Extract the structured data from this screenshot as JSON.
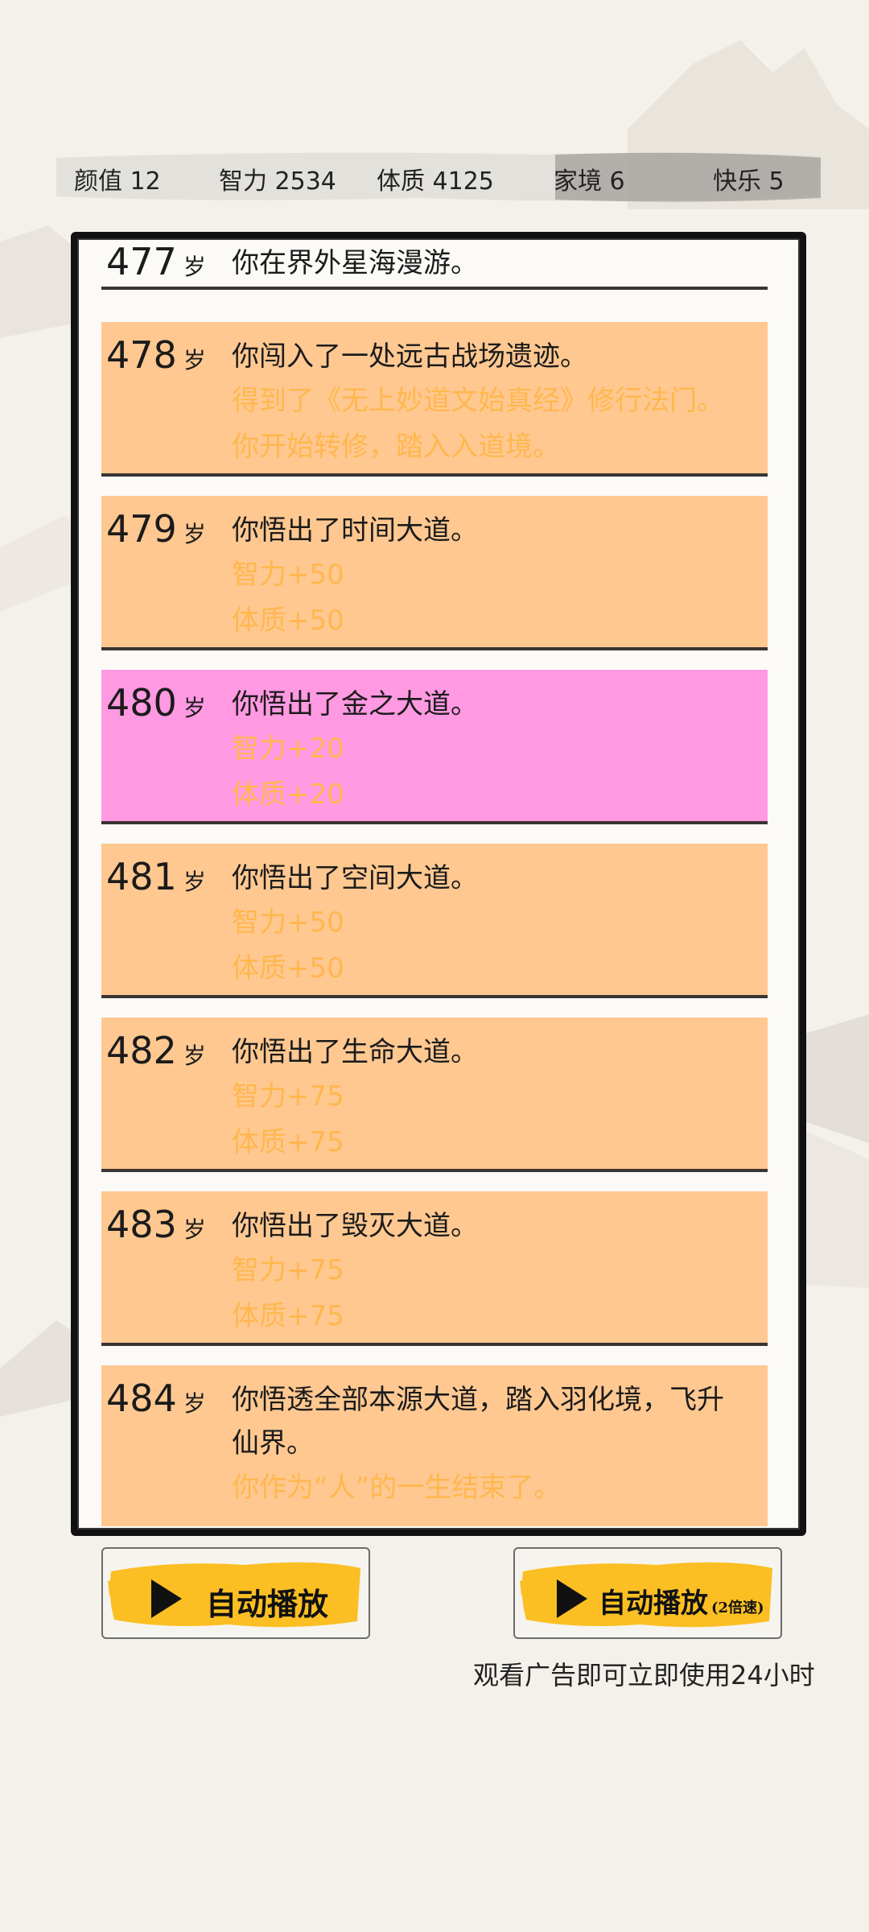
{
  "stats": {
    "appearance": "颜值 12",
    "intelligence": "智力 2534",
    "constitution": "体质 4125",
    "family": "家境 6",
    "happiness": "快乐 5"
  },
  "age_unit": "岁",
  "entries": [
    {
      "age": "477",
      "main": "你在界外星海漫游。",
      "sub": []
    },
    {
      "age": "478",
      "main": "你闯入了一处远古战场遗迹。",
      "sub": [
        "得到了《无上妙道文始真经》修行法门。",
        "你开始转修，踏入入道境。"
      ]
    },
    {
      "age": "479",
      "main": "你悟出了时间大道。",
      "sub": [
        "智力+50",
        "体质+50"
      ]
    },
    {
      "age": "480",
      "main": "你悟出了金之大道。",
      "sub": [
        "智力+20",
        "体质+20"
      ]
    },
    {
      "age": "481",
      "main": "你悟出了空间大道。",
      "sub": [
        "智力+50",
        "体质+50"
      ]
    },
    {
      "age": "482",
      "main": "你悟出了生命大道。",
      "sub": [
        "智力+75",
        "体质+75"
      ]
    },
    {
      "age": "483",
      "main": "你悟出了毁灭大道。",
      "sub": [
        "智力+75",
        "体质+75"
      ]
    },
    {
      "age": "484",
      "main": "你悟透全部本源大道，踏入羽化境，飞升",
      "main2": "仙界。",
      "sub": [
        "你作为“人”的一生结束了。"
      ]
    }
  ],
  "buttons": {
    "auto_play": "自动播放",
    "auto_play_2x": "自动播放",
    "auto_play_2x_sub": "(2倍速)",
    "ad_note": "观看广告即可立即使用24小时"
  },
  "colors": {
    "entry_bg": "#ffc891",
    "special_bg": "#ff99e2",
    "sub_text": "#ffb74d",
    "button_brush": "#fbbf24"
  }
}
